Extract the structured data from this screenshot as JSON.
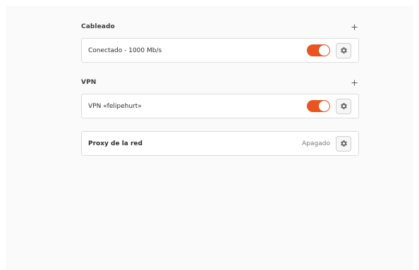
{
  "wired": {
    "title": "Cableado",
    "add_icon": "plus-icon",
    "connection": {
      "label": "Conectado - 1000 Mb/s",
      "enabled": true,
      "settings_icon": "gear-icon"
    }
  },
  "vpn": {
    "title": "VPN",
    "add_icon": "plus-icon",
    "connection": {
      "label": "VPN «felipehurt»",
      "enabled": true,
      "settings_icon": "gear-icon"
    }
  },
  "proxy": {
    "label": "Proxy de la red",
    "status": "Apagado",
    "settings_icon": "gear-icon"
  },
  "colors": {
    "accent": "#e95420",
    "card_border": "#dcdcdc",
    "background": "#fafafa"
  }
}
